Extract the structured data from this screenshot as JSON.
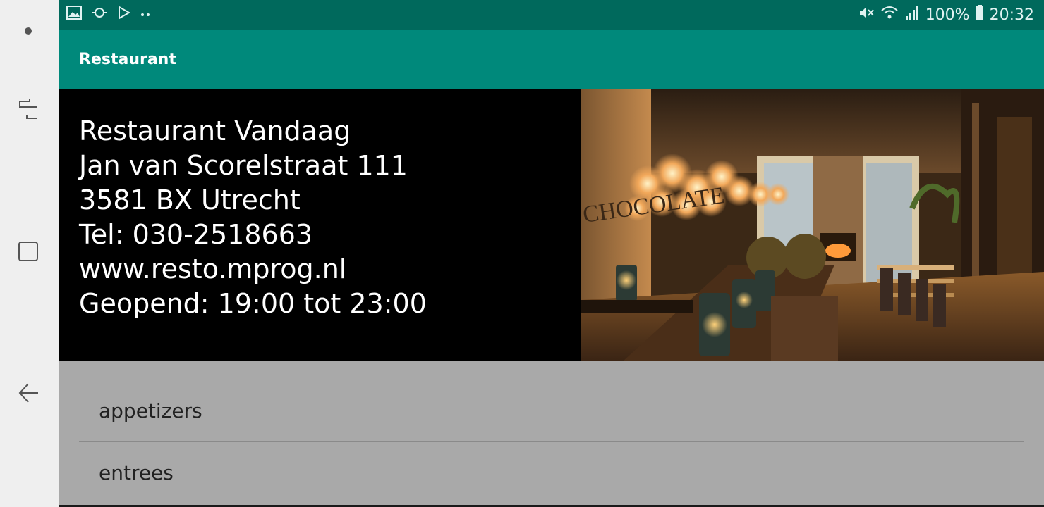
{
  "status_bar": {
    "battery": "100%",
    "time": "20:32",
    "icons_left": [
      "image-icon",
      "sync-icon",
      "play-store-icon",
      "more-dots-icon"
    ],
    "icons_right": [
      "mute-icon",
      "wifi-icon",
      "signal-icon",
      "battery-icon"
    ]
  },
  "app_bar": {
    "title": "Restaurant"
  },
  "info": {
    "name": "Restaurant Vandaag",
    "street": "Jan van Scorelstraat 111",
    "city": "3581 BX Utrecht",
    "phone": "Tel: 030-2518663",
    "website": "www.resto.mprog.nl",
    "hours": "Geopend: 19:00 tot 23:00"
  },
  "categories": [
    {
      "label": "appetizers"
    },
    {
      "label": "entrees"
    }
  ],
  "colors": {
    "status_bar": "#00695c",
    "app_bar": "#00897b",
    "list_background": "#a9a9a9"
  }
}
